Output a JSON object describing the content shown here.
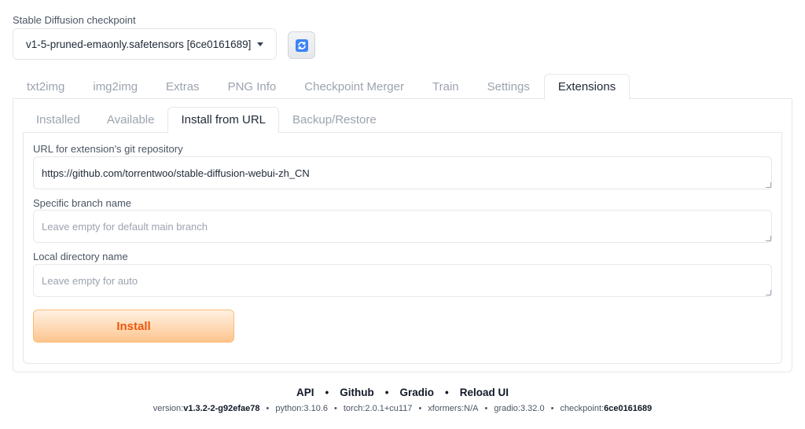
{
  "checkpoint": {
    "label": "Stable Diffusion checkpoint",
    "value": "v1-5-pruned-emaonly.safetensors [6ce0161689]",
    "refresh_icon": "refresh-icon"
  },
  "main_tabs": [
    {
      "label": "txt2img",
      "active": false
    },
    {
      "label": "img2img",
      "active": false
    },
    {
      "label": "Extras",
      "active": false
    },
    {
      "label": "PNG Info",
      "active": false
    },
    {
      "label": "Checkpoint Merger",
      "active": false
    },
    {
      "label": "Train",
      "active": false
    },
    {
      "label": "Settings",
      "active": false
    },
    {
      "label": "Extensions",
      "active": true
    }
  ],
  "sub_tabs": [
    {
      "label": "Installed",
      "active": false
    },
    {
      "label": "Available",
      "active": false
    },
    {
      "label": "Install from URL",
      "active": true
    },
    {
      "label": "Backup/Restore",
      "active": false
    }
  ],
  "form": {
    "url": {
      "label": "URL for extension's git repository",
      "value": "https://github.com/torrentwoo/stable-diffusion-webui-zh_CN",
      "placeholder": ""
    },
    "branch": {
      "label": "Specific branch name",
      "value": "",
      "placeholder": "Leave empty for default main branch"
    },
    "directory": {
      "label": "Local directory name",
      "value": "",
      "placeholder": "Leave empty for auto"
    },
    "install_label": "Install"
  },
  "footer": {
    "links": [
      "API",
      "Github",
      "Gradio",
      "Reload UI"
    ],
    "separator": "•",
    "info": [
      {
        "key": "version: ",
        "value": "v1.3.2-2-g92efae78"
      },
      {
        "key": "python: ",
        "value": "3.10.6"
      },
      {
        "key": "torch: ",
        "value": "2.0.1+cu117"
      },
      {
        "key": "xformers: ",
        "value": "N/A"
      },
      {
        "key": "gradio: ",
        "value": "3.32.0"
      },
      {
        "key": "checkpoint: ",
        "value": "6ce0161689"
      }
    ]
  },
  "colors": {
    "accent": "#ea580c",
    "button_gradient_top": "#fff1e2",
    "button_gradient_bottom": "#fdc58f",
    "refresh_icon": "#2563eb"
  }
}
